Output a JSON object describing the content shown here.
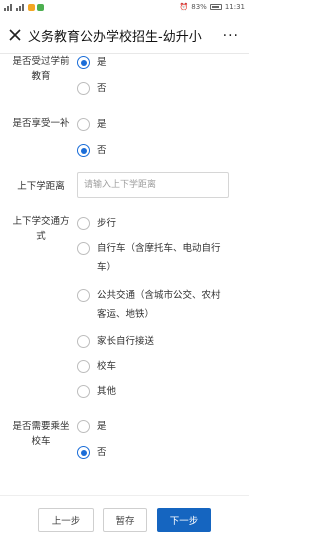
{
  "status_bar": {
    "battery_pct": "83%",
    "time": "11:31"
  },
  "header": {
    "title": "义务教育公办学校招生-幼升小",
    "more": "···"
  },
  "form": {
    "preschool": {
      "label": "是否受过学前教育",
      "options": [
        "是",
        "否"
      ],
      "selected": "是"
    },
    "subsidy": {
      "label": "是否享受一补",
      "options": [
        "是",
        "否"
      ],
      "selected": "否"
    },
    "distance": {
      "label": "上下学距离",
      "placeholder": "请输入上下学距离",
      "value": ""
    },
    "transport": {
      "label": "上下学交通方式",
      "options": [
        "步行",
        "自行车（含摩托车、电动自行车）",
        "公共交通（含城市公交、农村客运、地铁）",
        "家长自行接送",
        "校车",
        "其他"
      ],
      "selected": ""
    },
    "school_bus": {
      "label": "是否需要乘坐校车",
      "options": [
        "是",
        "否"
      ],
      "selected": "否"
    }
  },
  "footer": {
    "prev_label": "上一步",
    "save_label": "暂存",
    "next_label": "下一步"
  },
  "colors": {
    "accent": "#1a6dd8",
    "button_primary": "#1565c0"
  }
}
